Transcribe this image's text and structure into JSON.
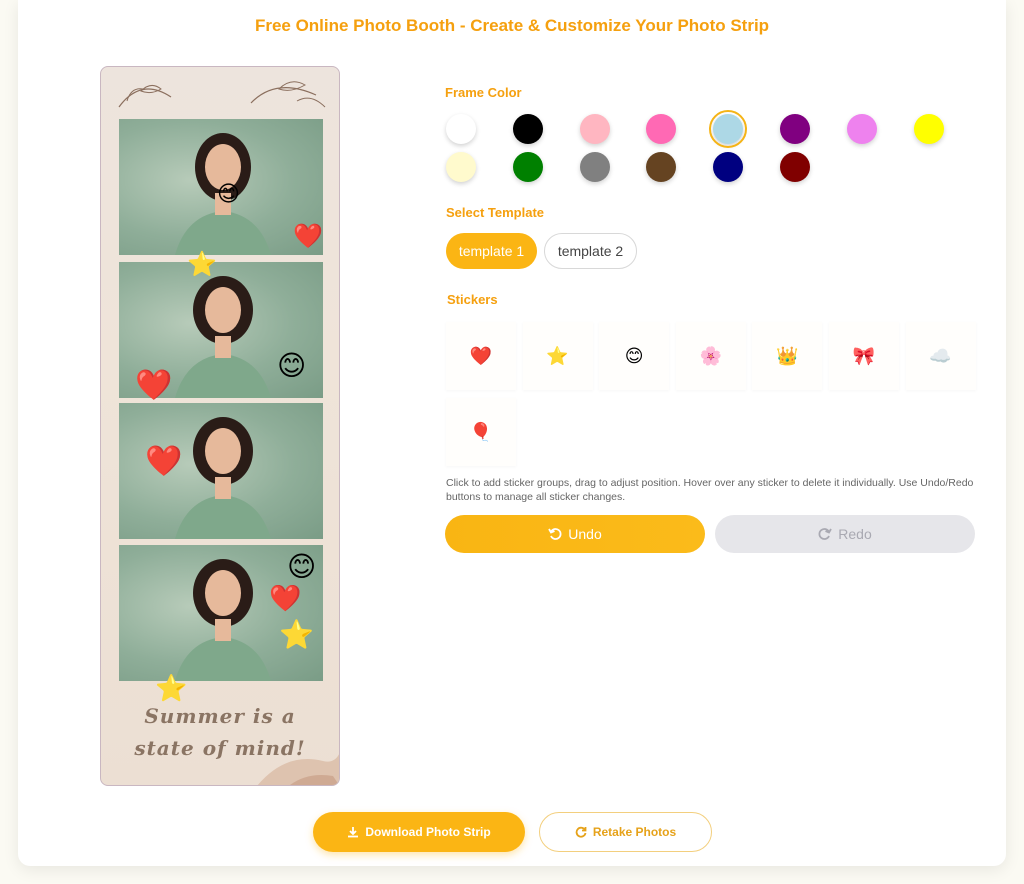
{
  "page": {
    "title": "Free Online Photo Booth - Create & Customize Your Photo Strip"
  },
  "strip": {
    "caption_line1": "Summer is a",
    "caption_line2": "state of mind!"
  },
  "frame_color": {
    "label": "Frame Color",
    "selected": "#add8e6",
    "colors": [
      "#ffffff",
      "#000000",
      "#ffb6c1",
      "#ff69b4",
      "#add8e6",
      "#800080",
      "#ee82ee",
      "#ffff00",
      "#fffacd",
      "#008000",
      "#808080",
      "#654321",
      "#000080",
      "#800000"
    ]
  },
  "template": {
    "label": "Select Template",
    "options": [
      "template 1",
      "template 2"
    ],
    "selected": "template 1"
  },
  "stickers": {
    "label": "Stickers",
    "items": [
      "❤️",
      "⭐",
      "😊",
      "🌸",
      "👑",
      "🎀",
      "☁️",
      "🎈"
    ],
    "help": "Click to add sticker groups, drag to adjust position. Hover over any sticker to delete it individually. Use Undo/Redo buttons to manage all sticker changes."
  },
  "history": {
    "undo_label": "Undo",
    "redo_label": "Redo"
  },
  "actions": {
    "download_label": "Download Photo Strip",
    "retake_label": "Retake Photos"
  },
  "icons": {
    "undo": "undo-icon",
    "redo": "redo-icon",
    "download": "download-icon",
    "retake": "refresh-icon"
  }
}
